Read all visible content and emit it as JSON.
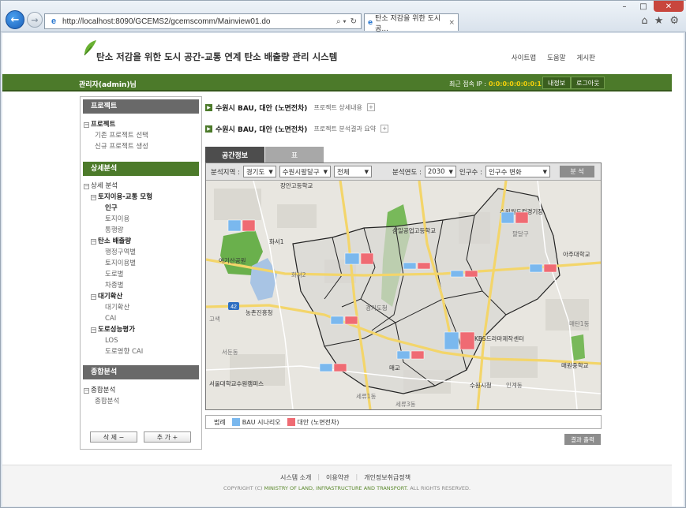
{
  "browser": {
    "url": "http://localhost:8090/GCEMS2/gcemscomm/Mainview01.do",
    "tab_title": "탄소 저감을 위한 도시 공...",
    "tab_close": "×"
  },
  "header": {
    "site_title": "탄소 저감을 위한 도시 공간-교통 연계 탄소 배출량 관리 시스템",
    "links": [
      "사이트맵",
      "도움말",
      "게시판"
    ]
  },
  "userbar": {
    "user": "관리자(admin)님",
    "last_ip_label": "최근 접속 IP :",
    "last_ip_value": "0:0:0:0:0:0:0:1",
    "my_info": "내정보",
    "logout": "로그아웃"
  },
  "sidebar": {
    "project_head": "프로젝트",
    "project_root": "프로젝트",
    "project_items": [
      "기존 프로젝트 선택",
      "신규 프로젝트 생성"
    ],
    "detail_head": "상세분석",
    "detail_root": "상세 분석",
    "landuse": "토지이용-교통 모형",
    "landuse_items": [
      "인구",
      "토지이용",
      "통행량"
    ],
    "carbon": "탄소 배출량",
    "carbon_items": [
      "행정구역별",
      "토지이용별",
      "도로별",
      "차종별"
    ],
    "air": "대기확산",
    "air_items": [
      "대기확산",
      "CAI"
    ],
    "road": "도로성능평가",
    "road_items": [
      "LOS",
      "도로영향 CAI"
    ],
    "summary_head": "종합분석",
    "summary_root": "종합분석",
    "summary_items": [
      "종합분석"
    ],
    "delete_btn": "삭 제 −",
    "add_btn": "추 가 +"
  },
  "projects": [
    {
      "name": "수원시 BAU, 대안 (노면전차)",
      "desc": "프로젝트 상세내용"
    },
    {
      "name": "수원시 BAU, 대안 (노면전차)",
      "desc": "프로젝트 분석결과 요약"
    }
  ],
  "tabs": [
    "공간정보",
    "표"
  ],
  "filters": {
    "region_label": "분석지역 :",
    "province": "경기도",
    "district": "수원시팔달구",
    "dong": "전체",
    "year_label": "분석연도 :",
    "year": "2030",
    "pop_label": "인구수 :",
    "pop_change": "인구수 변화",
    "analyze": "분 석"
  },
  "map_labels": {
    "school1": "장안고등학교",
    "park": "여기산공원",
    "hwaseo": "화서1",
    "hwaseo2": "화서2",
    "seodun": "서둔동",
    "nongchon": "농촌진흥청",
    "route": "42",
    "univ": "서울대학교수원캠퍼스",
    "samil": "삼일공업고등학교",
    "suwon_wh": "수원월드컵경기장",
    "paldal": "팔달구",
    "ajou": "아주대학교",
    "gyeonggi": "경기도청",
    "mokcheon": "매교",
    "kbs": "KBS드라마제작센터",
    "maewon": "매원중학교",
    "suwon_city": "수원시청",
    "ingye": "인계동",
    "sewu": "세류1동",
    "sewu3": "세류3동",
    "gwanggyo": "매탄1동",
    "gosaek": "고색"
  },
  "legend": {
    "label": "범례",
    "bau": "BAU 시나리오",
    "alt": "대안 (노면전차)",
    "bau_color": "#7ab8ee",
    "alt_color": "#ef6b73"
  },
  "result_btn": "결과 출력",
  "footer": {
    "links": [
      "시스템 소개",
      "이용약관",
      "개인정보취급정책"
    ],
    "copyright_prefix": "COPYRIGHT (C)",
    "copyright_org": "MINISTRY OF LAND, INFRASTRUCTURE AND TRANSPORT.",
    "copyright_suffix": "ALL RIGHTS RESERVED."
  }
}
